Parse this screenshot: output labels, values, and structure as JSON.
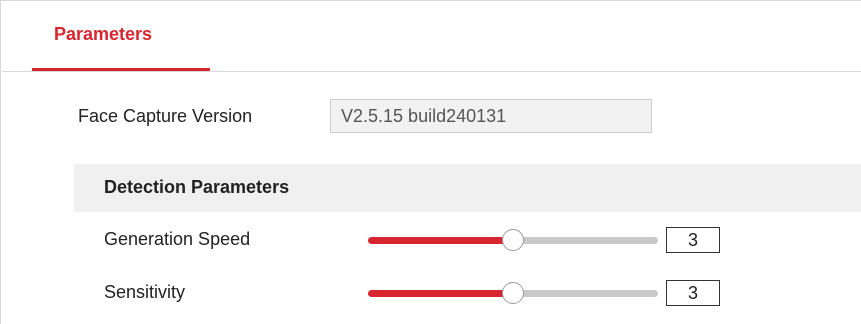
{
  "tabs": [
    {
      "label": "Parameters",
      "active": true
    }
  ],
  "face_capture": {
    "version_label": "Face Capture Version",
    "version_value": "V2.5.15 build240131"
  },
  "detection": {
    "title": "Detection Parameters",
    "params": [
      {
        "label": "Generation Speed",
        "value": "3",
        "level": 0.5
      },
      {
        "label": "Sensitivity",
        "value": "3",
        "level": 0.5
      }
    ]
  },
  "colors": {
    "accent": "#d7262f",
    "track": "#c9c9c9",
    "section_bg": "#f0f0f0",
    "readonly_field_bg": "#f2f2f2"
  }
}
